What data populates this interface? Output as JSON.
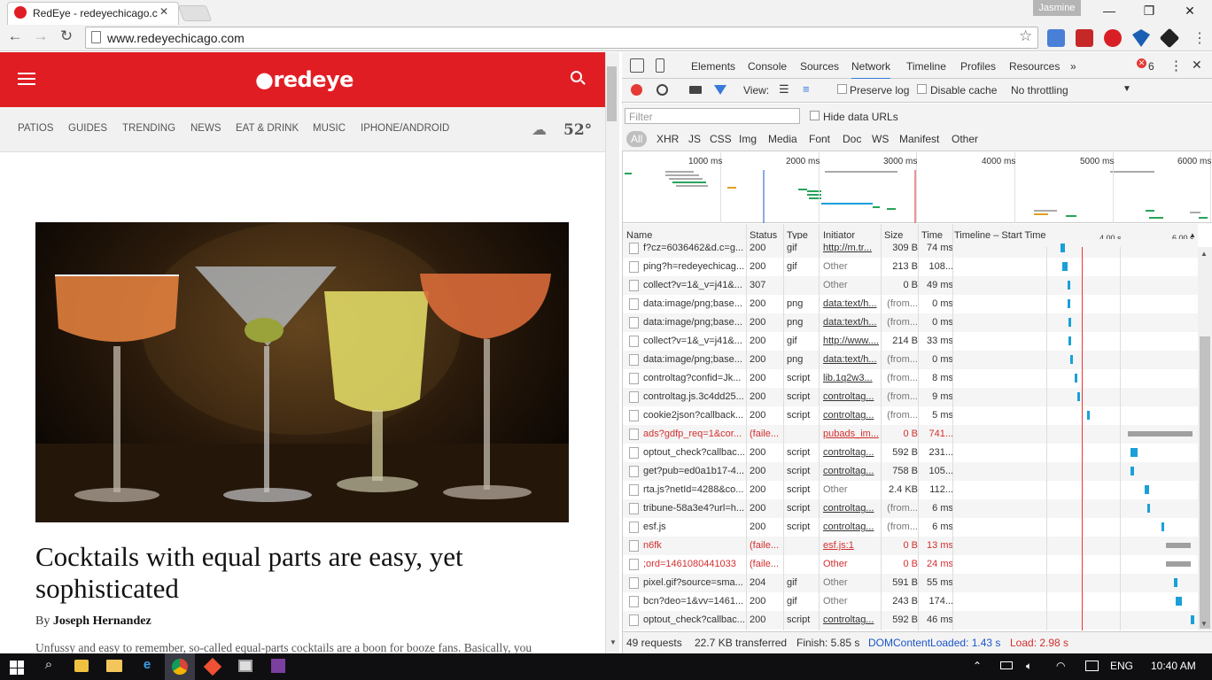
{
  "browser": {
    "tab_title": "RedEye - redeyechicago.c",
    "tab_close": "✕",
    "user": "Jasmine",
    "url": "www.redeyechicago.com",
    "window_controls": {
      "minimize": "—",
      "maximize": "❐",
      "close": "✕"
    }
  },
  "page": {
    "logo": "●redeye",
    "nav": [
      "PATIOS",
      "GUIDES",
      "TRENDING",
      "NEWS",
      "EAT & DRINK",
      "MUSIC",
      "IPHONE/ANDROID"
    ],
    "temperature": "52°",
    "headline": "Cocktails with equal parts are easy, yet sophisticated",
    "byline_prefix": "By",
    "author": "Joseph Hernandez",
    "teaser": "Unfussy and easy to remember, so-called equal-parts cocktails are a boon for booze fans. Basically, you"
  },
  "devtools": {
    "tabs": [
      "Elements",
      "Console",
      "Sources",
      "Network",
      "Timeline",
      "Profiles",
      "Resources"
    ],
    "active_tab": "Network",
    "more": "»",
    "error_count": "6",
    "view_label": "View:",
    "preserve_log": "Preserve log",
    "disable_cache": "Disable cache",
    "throttling": "No throttling",
    "filter_placeholder": "Filter",
    "hide_data_urls": "Hide data URLs",
    "filter_types": [
      "All",
      "XHR",
      "JS",
      "CSS",
      "Img",
      "Media",
      "Font",
      "Doc",
      "WS",
      "Manifest",
      "Other"
    ],
    "overview_ticks": [
      "1000 ms",
      "2000 ms",
      "3000 ms",
      "4000 ms",
      "5000 ms",
      "6000 ms"
    ],
    "columns": [
      "Name",
      "Status",
      "Type",
      "Initiator",
      "Size",
      "Time",
      "Timeline – Start Time"
    ],
    "timeline_ticks": [
      "4.00 s",
      "6.00 s"
    ],
    "rows": [
      {
        "name": "f?cz=6036462&d.c=g...",
        "status": "200",
        "type": "gif",
        "initiator": "http://m.tr...",
        "size": "309 B",
        "time": "74 ms",
        "error": false,
        "bar_start": 0.44,
        "bar_len": 0.02
      },
      {
        "name": "ping?h=redeyechicag...",
        "status": "200",
        "type": "gif",
        "initiator": "Other",
        "size": "213 B",
        "time": "108...",
        "error": false,
        "bar_start": 0.45,
        "bar_len": 0.02
      },
      {
        "name": "collect?v=1&_v=j41&...",
        "status": "307",
        "type": "",
        "initiator": "Other",
        "size": "0 B",
        "time": "49 ms",
        "error": false,
        "bar_start": 0.47,
        "bar_len": 0.012
      },
      {
        "name": "data:image/png;base...",
        "status": "200",
        "type": "png",
        "initiator": "data:text/h...",
        "size": "(from...",
        "time": "0 ms",
        "error": false,
        "bar_start": 0.472,
        "bar_len": 0.008
      },
      {
        "name": "data:image/png;base...",
        "status": "200",
        "type": "png",
        "initiator": "data:text/h...",
        "size": "(from...",
        "time": "0 ms",
        "error": false,
        "bar_start": 0.474,
        "bar_len": 0.008
      },
      {
        "name": "collect?v=1&_v=j41&...",
        "status": "200",
        "type": "gif",
        "initiator": "http://www....",
        "size": "214 B",
        "time": "33 ms",
        "error": false,
        "bar_start": 0.476,
        "bar_len": 0.01
      },
      {
        "name": "data:image/png;base...",
        "status": "200",
        "type": "png",
        "initiator": "data:text/h...",
        "size": "(from...",
        "time": "0 ms",
        "error": false,
        "bar_start": 0.48,
        "bar_len": 0.008
      },
      {
        "name": "controltag?confid=Jk...",
        "status": "200",
        "type": "script",
        "initiator": "lib.1q2w3...",
        "size": "(from...",
        "time": "8 ms",
        "error": false,
        "bar_start": 0.5,
        "bar_len": 0.008
      },
      {
        "name": "controltag.js.3c4dd25...",
        "status": "200",
        "type": "script",
        "initiator": "controltag...",
        "size": "(from...",
        "time": "9 ms",
        "error": false,
        "bar_start": 0.51,
        "bar_len": 0.008
      },
      {
        "name": "cookie2json?callback...",
        "status": "200",
        "type": "script",
        "initiator": "controltag...",
        "size": "(from...",
        "time": "5 ms",
        "error": false,
        "bar_start": 0.55,
        "bar_len": 0.008
      },
      {
        "name": "ads?gdfp_req=1&cor...",
        "status": "(faile...",
        "type": "",
        "initiator": "pubads_im...",
        "size": "0 B",
        "time": "741...",
        "error": true,
        "bar_start": 0.72,
        "bar_len": 0.27
      },
      {
        "name": "optout_check?callbac...",
        "status": "200",
        "type": "script",
        "initiator": "controltag...",
        "size": "592 B",
        "time": "231...",
        "error": false,
        "bar_start": 0.73,
        "bar_len": 0.03
      },
      {
        "name": "get?pub=ed0a1b17-4...",
        "status": "200",
        "type": "script",
        "initiator": "controltag...",
        "size": "758 B",
        "time": "105...",
        "error": false,
        "bar_start": 0.73,
        "bar_len": 0.015
      },
      {
        "name": "rta.js?netId=4288&co...",
        "status": "200",
        "type": "script",
        "initiator": "Other",
        "size": "2.4 KB",
        "time": "112...",
        "error": false,
        "bar_start": 0.79,
        "bar_len": 0.02
      },
      {
        "name": "tribune-58a3e4?url=h...",
        "status": "200",
        "type": "script",
        "initiator": "controltag...",
        "size": "(from...",
        "time": "6 ms",
        "error": false,
        "bar_start": 0.8,
        "bar_len": 0.008
      },
      {
        "name": "esf.js",
        "status": "200",
        "type": "script",
        "initiator": "controltag...",
        "size": "(from...",
        "time": "6 ms",
        "error": false,
        "bar_start": 0.86,
        "bar_len": 0.008
      },
      {
        "name": "n6fk",
        "status": "(faile...",
        "type": "",
        "initiator": "esf.js:1",
        "size": "0 B",
        "time": "13 ms",
        "error": true,
        "bar_start": 0.88,
        "bar_len": 0.1
      },
      {
        "name": ";ord=1461080441033",
        "status": "(faile...",
        "type": "",
        "initiator": "Other",
        "size": "0 B",
        "time": "24 ms",
        "error": true,
        "bar_start": 0.88,
        "bar_len": 0.1
      },
      {
        "name": "pixel.gif?source=sma...",
        "status": "204",
        "type": "gif",
        "initiator": "Other",
        "size": "591 B",
        "time": "55 ms",
        "error": false,
        "bar_start": 0.91,
        "bar_len": 0.018
      },
      {
        "name": "bcn?deo=1&vv=1461...",
        "status": "200",
        "type": "gif",
        "initiator": "Other",
        "size": "243 B",
        "time": "174...",
        "error": false,
        "bar_start": 0.92,
        "bar_len": 0.025
      },
      {
        "name": "optout_check?callbac...",
        "status": "200",
        "type": "script",
        "initiator": "controltag...",
        "size": "592 B",
        "time": "46 ms",
        "error": false,
        "bar_start": 0.98,
        "bar_len": 0.015
      }
    ],
    "status": {
      "requests": "49 requests",
      "transferred": "22.7 KB transferred",
      "finish": "Finish: 5.85 s",
      "domcontentloaded": "DOMContentLoaded: 1.43 s",
      "load": "Load: 2.98 s"
    },
    "colors": {
      "error": "#d32f2f",
      "dcl": "#1a55c9",
      "load": "#d32f2f",
      "waterfall": "#1aa0d8",
      "waterfall_wait": "#27a35a",
      "failed_bar": "#a0a0a0"
    }
  },
  "taskbar": {
    "language": "ENG",
    "time": "10:40 AM"
  }
}
